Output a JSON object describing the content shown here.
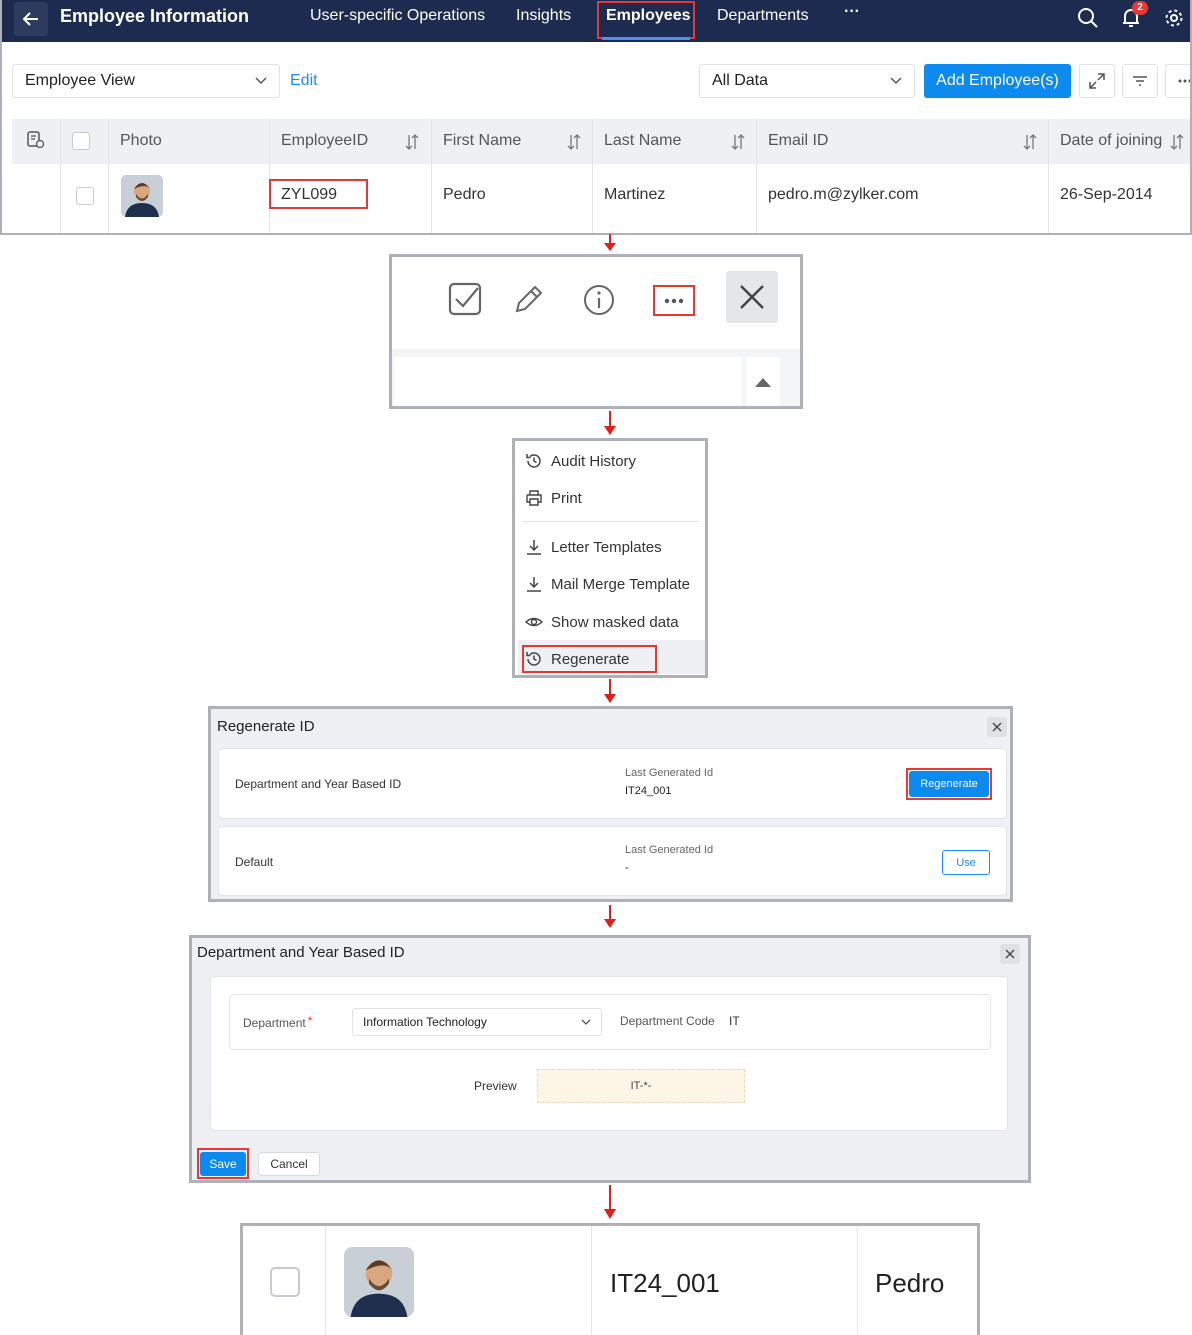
{
  "app": {
    "title": "Employee Information",
    "nav": [
      "User-specific Operations",
      "Insights",
      "Employees",
      "Departments",
      "···"
    ],
    "notifications_count": "2"
  },
  "toolbar": {
    "view_label": "Employee View",
    "edit_label": "Edit",
    "filter_label": "All Data",
    "add_label": "Add Employee(s)"
  },
  "table": {
    "columns": [
      "Photo",
      "EmployeeID",
      "First Name",
      "Last Name",
      "Email ID",
      "Date of joining"
    ],
    "row": {
      "employee_id": "ZYL099",
      "first_name": "Pedro",
      "last_name": "Martinez",
      "email": "pedro.m@zylker.com",
      "date_of_joining": "26-Sep-2014"
    }
  },
  "record_toolbar": {
    "icons": [
      "check-square-icon",
      "pencil-icon",
      "info-icon",
      "more-icon",
      "close-icon"
    ],
    "more_label": "···"
  },
  "menu": {
    "items": [
      "Audit History",
      "Print",
      "Letter Templates",
      "Mail Merge Template",
      "Show masked data",
      "Regenerate"
    ]
  },
  "regenerate_modal": {
    "title": "Regenerate ID",
    "options": [
      {
        "name": "Department and Year Based ID",
        "last_label": "Last Generated Id",
        "last_value": "IT24_001",
        "action": "Regenerate"
      },
      {
        "name": "Default",
        "last_label": "Last Generated Id",
        "last_value": "-",
        "action": "Use"
      }
    ]
  },
  "dept_modal": {
    "title": "Department and Year Based ID",
    "department_label": "Department",
    "required_mark": "*",
    "department_value": "Information Technology",
    "code_label": "Department Code",
    "code_value": "IT",
    "preview_label": "Preview",
    "preview_value": "IT-*-",
    "save_label": "Save",
    "cancel_label": "Cancel"
  },
  "result_row": {
    "employee_id": "IT24_001",
    "first_name": "Pedro"
  },
  "colors": {
    "topbar": "#1c2b4f",
    "primary": "#0d8af0",
    "highlight": "#e53935",
    "arrow": "#e0201a",
    "link": "#1a8cff"
  }
}
